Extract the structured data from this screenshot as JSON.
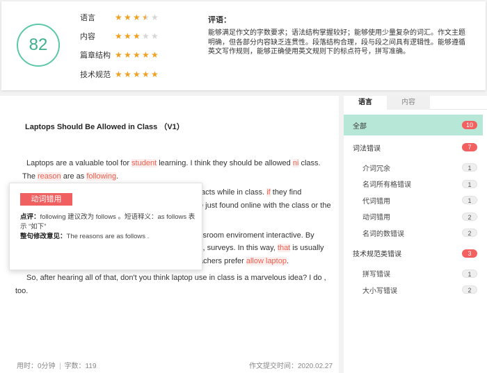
{
  "score": "82",
  "ratings": [
    {
      "label": "语言",
      "stars": 3.5
    },
    {
      "label": "内容",
      "stars": 3
    },
    {
      "label": "篇章结构",
      "stars": 5
    },
    {
      "label": "技术规范",
      "stars": 5
    }
  ],
  "comment": {
    "title": "评语：",
    "text": "能够满足作文的字数要求；语法结构掌握较好；能够使用少量复杂的词汇。作文主题明确，但各部分内容缺乏连贯性。段落结构合理，段与段之间具有逻辑性。能够遵循英文写作规则，能够正确使用英文规则下的标点符号，拼写准确。"
  },
  "essay": {
    "title": "Laptops Should Be Allowed in Class （V1）",
    "p1": [
      {
        "t": "Laptops are a valuable tool for "
      },
      {
        "t": "student",
        "e": true
      },
      {
        "t": " learning.   I think they should be allowed "
      },
      {
        "t": "ni",
        "e": true
      },
      {
        "t": " class.   The "
      },
      {
        "t": "reason",
        "e": true
      },
      {
        "t": " are as "
      },
      {
        "t": "following",
        "e": true
      },
      {
        "t": "."
      }
    ],
    "p2a": [
      {
        "t": "facts while in class.   "
      },
      {
        "t": "if",
        "e": true
      },
      {
        "t": " they find"
      }
    ],
    "p2b": [
      {
        "t": "e just found online with the class or the"
      }
    ],
    "p3a": [
      {
        "t": "ssroom enviroment interactive.   By"
      }
    ],
    "p3b": [
      {
        "t": "s, surveys.   In this way, "
      },
      {
        "t": "that",
        "e": true
      },
      {
        "t": " is usually"
      }
    ],
    "p3c": [
      {
        "t": "achers prefer "
      },
      {
        "t": "allow laptop",
        "e": true
      },
      {
        "t": "."
      }
    ],
    "p4": "So, after hearing all of that, don't you think laptop use in class is a marvelous idea?   I do , too."
  },
  "popup": {
    "tag": "动词错用",
    "comment_label": "点评：",
    "comment_text": "following 建议改为 follows 。短语释义：as follows 表示 “如下”",
    "revise_label": "整句修改意见：",
    "revise_text": "The reasons are as follows ."
  },
  "footer": {
    "time": "用时：0分钟",
    "words": "字数：119",
    "submitted": "作文提交时间：2020.02.27"
  },
  "tabs": [
    "语言",
    "内容"
  ],
  "side": {
    "all": {
      "label": "全部",
      "count": "10"
    },
    "groups": [
      {
        "label": "词法错误",
        "count": "7",
        "items": [
          {
            "label": "介词冗余",
            "count": "1"
          },
          {
            "label": "名词所有格错误",
            "count": "1"
          },
          {
            "label": "代词错用",
            "count": "1"
          },
          {
            "label": "动词错用",
            "count": "2"
          },
          {
            "label": "名词的数错误",
            "count": "2"
          }
        ]
      },
      {
        "label": "技术规范类错误",
        "count": "3",
        "items": [
          {
            "label": "拼写错误",
            "count": "1"
          },
          {
            "label": "大小写错误",
            "count": "2"
          }
        ]
      }
    ]
  },
  "colors": {
    "accent": "#5cc8a8",
    "error": "#f06050",
    "star": "#f0a020"
  }
}
